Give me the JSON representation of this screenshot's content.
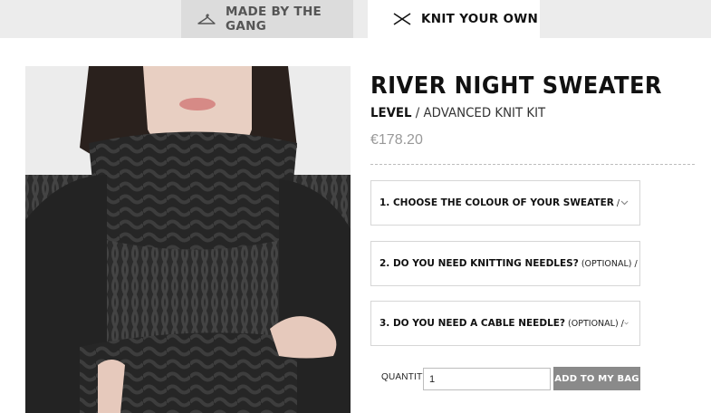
{
  "tabs": {
    "made": {
      "label": "MADE BY THE GANG",
      "icon": "hanger-icon"
    },
    "knit": {
      "label": "KNIT YOUR OWN",
      "icon": "crossed-needles-icon"
    }
  },
  "product": {
    "title": "RIVER NIGHT SWEATER",
    "level_label": "LEVEL",
    "level_value": " / ADVANCED KNIT KIT",
    "price": "€178.20",
    "image_alt": "Model wearing chunky black cable-knit turtleneck sweater"
  },
  "options": [
    {
      "label": "1. CHOOSE THE COLOUR OF YOUR SWEATER",
      "optional": "",
      "suffix": " /"
    },
    {
      "label": "2. DO YOU NEED KNITTING NEEDLES?",
      "optional": " (OPTIONAL)",
      "suffix": " /"
    },
    {
      "label": "3. DO YOU NEED A CABLE NEEDLE?",
      "optional": " (OPTIONAL)",
      "suffix": " /"
    }
  ],
  "purchase": {
    "quantity_label": "QUANTITY",
    "quantity_value": "1",
    "add_button": "ADD TO MY BAG"
  },
  "colors": {
    "tabbar_bg": "#ececec",
    "inactive_tab_bg": "#dcdcdc",
    "sweater": "#2a2a2a",
    "button_bg": "#8a8a8a",
    "price": "#999999"
  }
}
